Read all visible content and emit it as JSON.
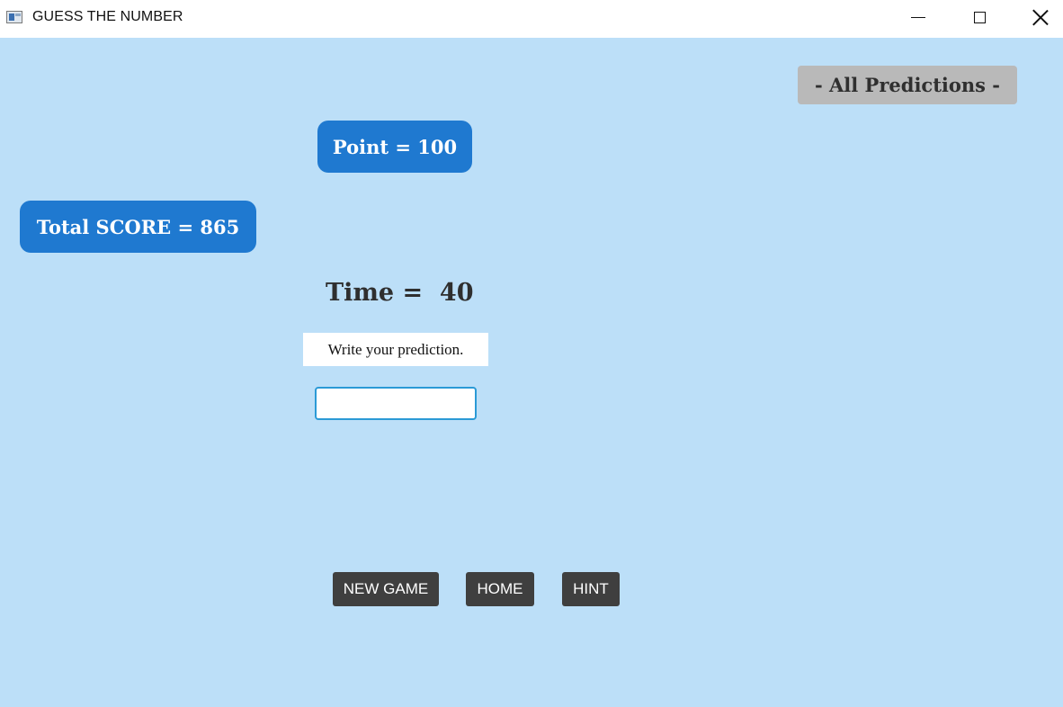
{
  "window": {
    "title": "GUESS THE NUMBER",
    "icon": "app-window-icon",
    "controls": {
      "minimize_icon": "minimize-icon",
      "maximize_icon": "maximize-icon",
      "close_icon": "close-icon"
    }
  },
  "game": {
    "all_predictions_label": "- All Predictions -",
    "point_label": "Point = 100",
    "total_score_label": "Total SCORE = 865",
    "time_label": "Time =  40",
    "prompt_text": "Write your prediction.",
    "guess_input_value": "",
    "buttons": {
      "new_game": "NEW GAME",
      "home": "HOME",
      "hint": "HINT"
    }
  },
  "colors": {
    "background": "#bcdff8",
    "pill_blue": "#1f79d0",
    "all_predictions_gray": "#b9b9b9",
    "button_dark": "#3f3f3f",
    "input_border": "#2b9ad6"
  }
}
